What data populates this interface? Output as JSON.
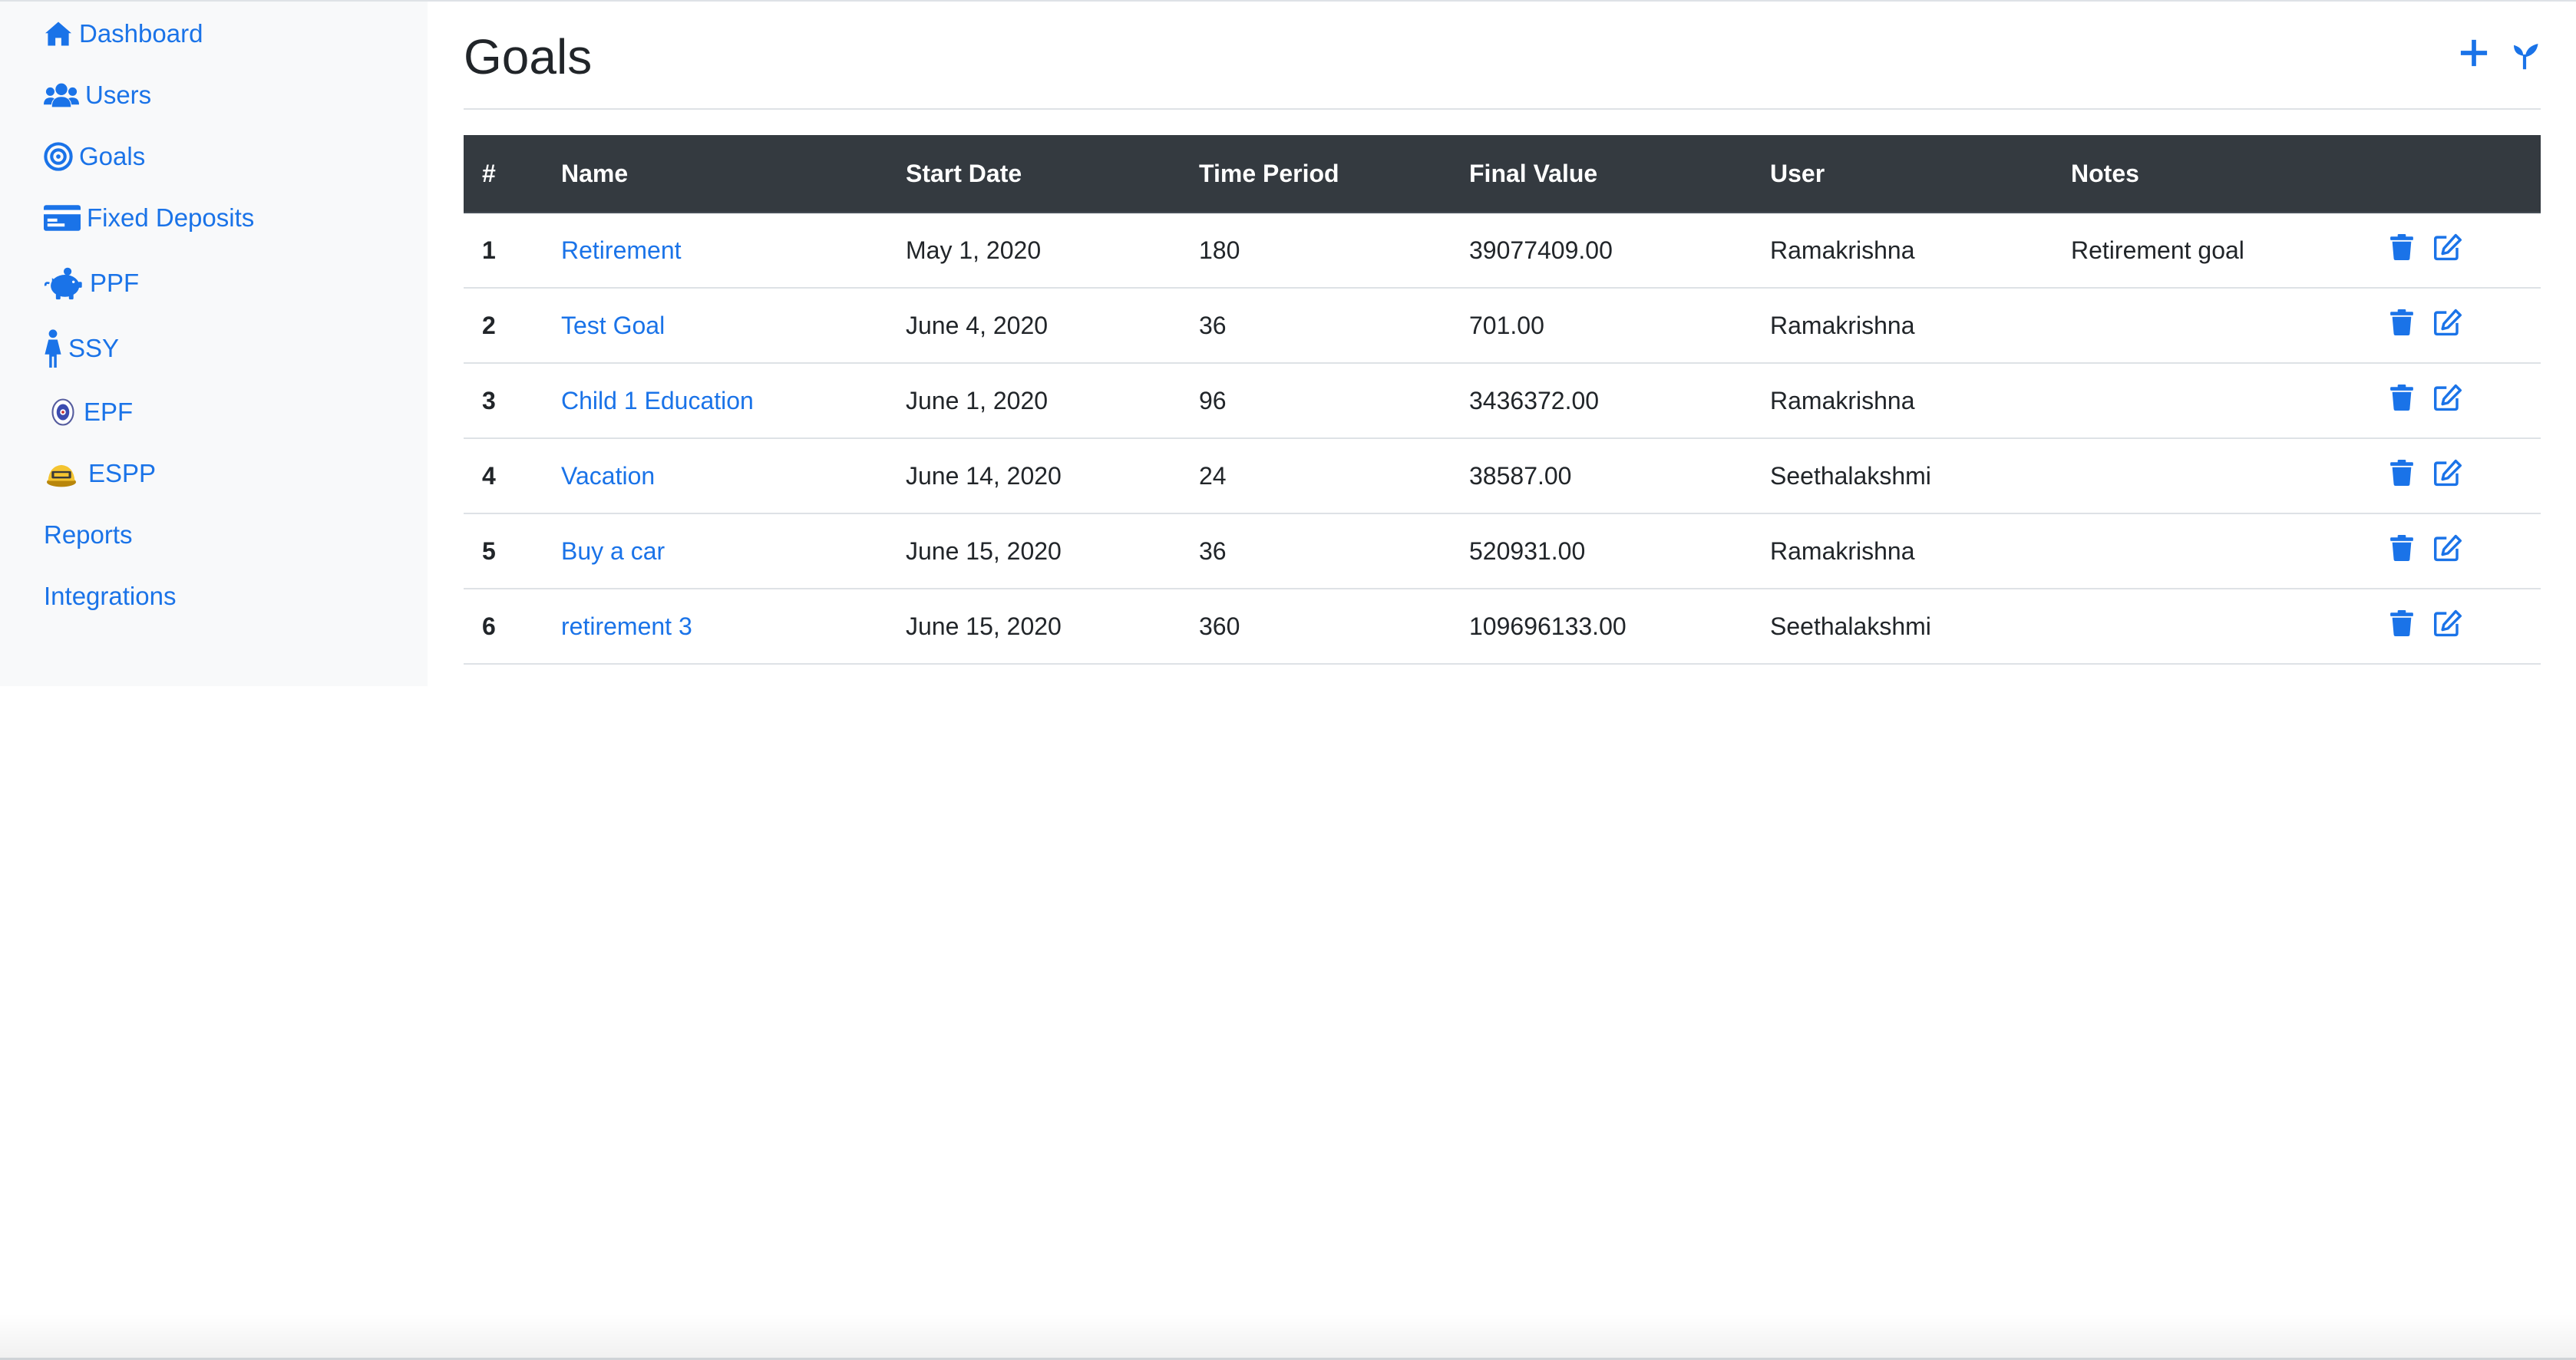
{
  "colors": {
    "accent": "#1a73e8",
    "header_bg": "#343a40",
    "sidebar_bg": "#f8f9fa"
  },
  "sidebar": {
    "items": [
      {
        "label": "Dashboard",
        "icon": "home-icon"
      },
      {
        "label": "Users",
        "icon": "users-icon"
      },
      {
        "label": "Goals",
        "icon": "target-icon"
      },
      {
        "label": "Fixed Deposits",
        "icon": "money-card-icon"
      },
      {
        "label": "PPF",
        "icon": "piggy-bank-icon"
      },
      {
        "label": "SSY",
        "icon": "girl-icon"
      },
      {
        "label": "EPF",
        "icon": "epf-logo-icon"
      },
      {
        "label": "ESPP",
        "icon": "espp-icon"
      },
      {
        "label": "Reports",
        "icon": ""
      },
      {
        "label": "Integrations",
        "icon": ""
      }
    ]
  },
  "page": {
    "title": "Goals",
    "actions": [
      {
        "icon": "plus-icon"
      },
      {
        "icon": "seedling-icon"
      }
    ]
  },
  "table": {
    "columns": [
      "#",
      "Name",
      "Start Date",
      "Time Period",
      "Final Value",
      "User",
      "Notes",
      ""
    ],
    "rows": [
      {
        "num": "1",
        "name": "Retirement",
        "start_date": "May 1, 2020",
        "time_period": "180",
        "final_value": "39077409.00",
        "user": "Ramakrishna",
        "notes": "Retirement goal"
      },
      {
        "num": "2",
        "name": "Test Goal",
        "start_date": "June 4, 2020",
        "time_period": "36",
        "final_value": "701.00",
        "user": "Ramakrishna",
        "notes": ""
      },
      {
        "num": "3",
        "name": "Child 1 Education",
        "start_date": "June 1, 2020",
        "time_period": "96",
        "final_value": "3436372.00",
        "user": "Ramakrishna",
        "notes": ""
      },
      {
        "num": "4",
        "name": "Vacation",
        "start_date": "June 14, 2020",
        "time_period": "24",
        "final_value": "38587.00",
        "user": "Seethalakshmi",
        "notes": ""
      },
      {
        "num": "5",
        "name": "Buy a car",
        "start_date": "June 15, 2020",
        "time_period": "36",
        "final_value": "520931.00",
        "user": "Ramakrishna",
        "notes": ""
      },
      {
        "num": "6",
        "name": "retirement 3",
        "start_date": "June 15, 2020",
        "time_period": "360",
        "final_value": "109696133.00",
        "user": "Seethalakshmi",
        "notes": ""
      }
    ],
    "row_actions": [
      {
        "icon": "trash-icon"
      },
      {
        "icon": "edit-icon"
      }
    ]
  }
}
